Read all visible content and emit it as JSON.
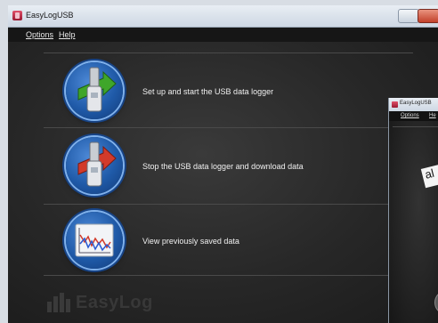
{
  "main_window": {
    "title": "EasyLogUSB",
    "menu": [
      "Options",
      "Help"
    ],
    "actions": [
      {
        "label": "Set up and start the USB data logger",
        "icon": "usb-logger-start-icon"
      },
      {
        "label": "Stop the USB data logger and download data",
        "icon": "usb-logger-stop-icon"
      },
      {
        "label": "View previously saved data",
        "icon": "saved-data-graph-icon"
      }
    ],
    "logo_text": "EasyLog"
  },
  "second_window": {
    "title": "EasyLogUSB",
    "menu": [
      "Options",
      "He"
    ],
    "partial_label": "al"
  },
  "colors": {
    "background": "#1b1b1b",
    "icon_blue": "#1f5aa8",
    "arrow_green": "#3fa62a",
    "arrow_red": "#d23a2a",
    "text": "#f0f0f0"
  }
}
